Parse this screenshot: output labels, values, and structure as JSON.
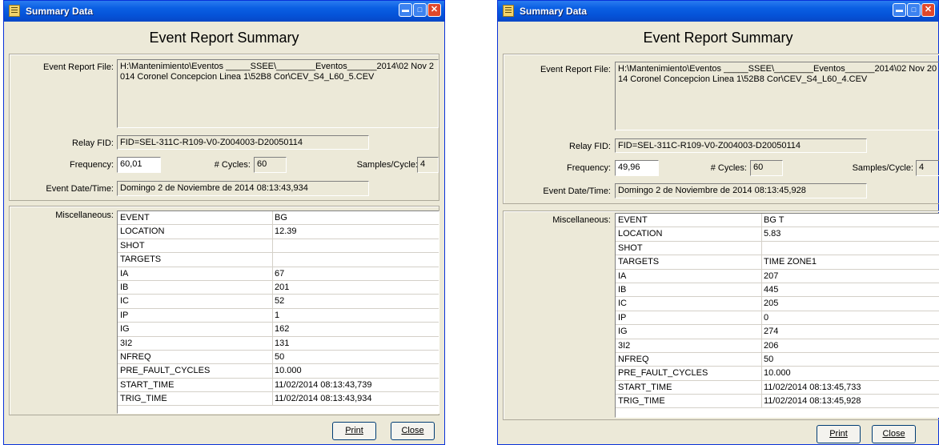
{
  "windows": [
    {
      "title": "Summary Data",
      "heading": "Event Report Summary",
      "labels": {
        "file": "Event Report File:",
        "relay": "Relay FID:",
        "frequency": "Frequency:",
        "cycles": "# Cycles:",
        "samples": "Samples/Cycle:",
        "datetime": "Event Date/Time:",
        "misc": "Miscellaneous:"
      },
      "file_path": "H:\\Mantenimiento\\Eventos _____SSEE\\________Eventos______2014\\02 Nov 2014 Coronel Concepcion Linea 1\\52B8 Cor\\CEV_S4_L60_5.CEV",
      "relay_fid": "FID=SEL-311C-R109-V0-Z004003-D20050114",
      "frequency": "60,01",
      "cycles": "60",
      "samples": "4",
      "datetime": "Domingo 2 de Noviembre de 2014  08:13:43,934",
      "rows": [
        {
          "key": "EVENT",
          "value": "BG"
        },
        {
          "key": "LOCATION",
          "value": "12.39"
        },
        {
          "key": "SHOT",
          "value": ""
        },
        {
          "key": "TARGETS",
          "value": ""
        },
        {
          "key": "IA",
          "value": "67"
        },
        {
          "key": "IB",
          "value": "201"
        },
        {
          "key": "IC",
          "value": "52"
        },
        {
          "key": "IP",
          "value": "1"
        },
        {
          "key": "IG",
          "value": "162"
        },
        {
          "key": "3I2",
          "value": "131"
        },
        {
          "key": "NFREQ",
          "value": "50"
        },
        {
          "key": "PRE_FAULT_CYCLES",
          "value": "10.000"
        },
        {
          "key": "START_TIME",
          "value": "11/02/2014 08:13:43,739"
        },
        {
          "key": "TRIG_TIME",
          "value": "11/02/2014 08:13:43,934"
        }
      ],
      "print_label": "Print",
      "close_label": "Close"
    },
    {
      "title": "Summary Data",
      "heading": "Event Report Summary",
      "labels": {
        "file": "Event Report File:",
        "relay": "Relay FID:",
        "frequency": "Frequency:",
        "cycles": "# Cycles:",
        "samples": "Samples/Cycle:",
        "datetime": "Event Date/Time:",
        "misc": "Miscellaneous:"
      },
      "file_path": "H:\\Mantenimiento\\Eventos _____SSEE\\________Eventos______2014\\02 Nov 2014 Coronel Concepcion Linea 1\\52B8 Cor\\CEV_S4_L60_4.CEV",
      "relay_fid": "FID=SEL-311C-R109-V0-Z004003-D20050114",
      "frequency": "49,96",
      "cycles": "60",
      "samples": "4",
      "datetime": "Domingo 2 de Noviembre de 2014  08:13:45,928",
      "rows": [
        {
          "key": "EVENT",
          "value": "BG T"
        },
        {
          "key": "LOCATION",
          "value": "5.83"
        },
        {
          "key": "SHOT",
          "value": ""
        },
        {
          "key": "TARGETS",
          "value": "TIME ZONE1"
        },
        {
          "key": "IA",
          "value": "207"
        },
        {
          "key": "IB",
          "value": "445"
        },
        {
          "key": "IC",
          "value": "205"
        },
        {
          "key": "IP",
          "value": "0"
        },
        {
          "key": "IG",
          "value": "274"
        },
        {
          "key": "3I2",
          "value": "206"
        },
        {
          "key": "NFREQ",
          "value": "50"
        },
        {
          "key": "PRE_FAULT_CYCLES",
          "value": "10.000"
        },
        {
          "key": "START_TIME",
          "value": "11/02/2014 08:13:45,733"
        },
        {
          "key": "TRIG_TIME",
          "value": "11/02/2014 08:13:45,928"
        }
      ],
      "print_label": "Print",
      "close_label": "Close"
    }
  ]
}
